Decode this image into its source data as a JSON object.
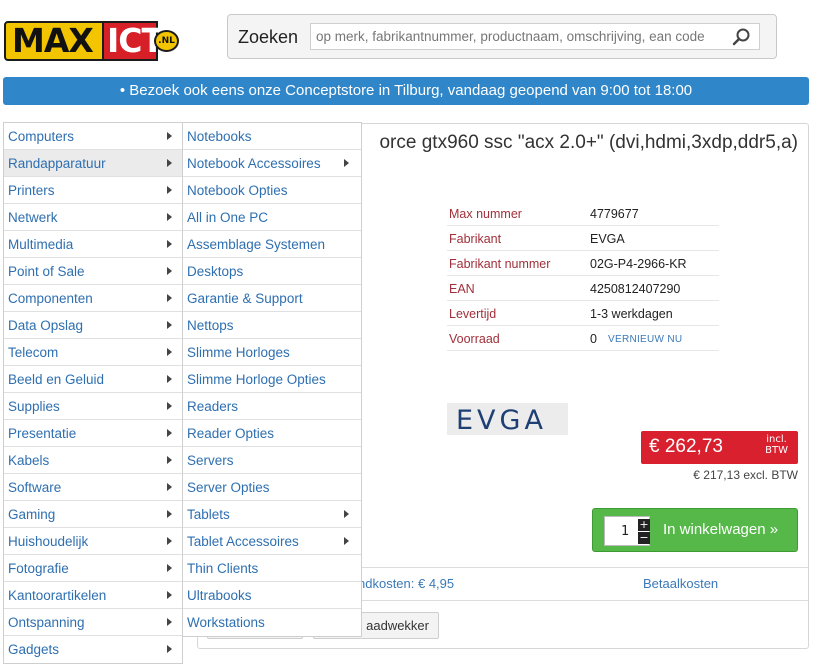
{
  "logo": {
    "max": "MAX",
    "ict": "ICT",
    "nl": ".NL"
  },
  "search": {
    "label": "Zoeken",
    "placeholder": "op merk, fabrikantnummer, productnaam, omschrijving, ean code"
  },
  "banner": {
    "text": "• Bezoek ook eens onze Conceptstore in Tilburg, vandaag geopend van 9:00 tot 18:00"
  },
  "categories": [
    {
      "label": "Computers",
      "has_sub": true
    },
    {
      "label": "Randapparatuur",
      "has_sub": true,
      "active": true
    },
    {
      "label": "Printers",
      "has_sub": true
    },
    {
      "label": "Netwerk",
      "has_sub": true
    },
    {
      "label": "Multimedia",
      "has_sub": true
    },
    {
      "label": "Point of Sale",
      "has_sub": true
    },
    {
      "label": "Componenten",
      "has_sub": true
    },
    {
      "label": "Data Opslag",
      "has_sub": true
    },
    {
      "label": "Telecom",
      "has_sub": true
    },
    {
      "label": "Beeld en Geluid",
      "has_sub": true
    },
    {
      "label": "Supplies",
      "has_sub": true
    },
    {
      "label": "Presentatie",
      "has_sub": true
    },
    {
      "label": "Kabels",
      "has_sub": true
    },
    {
      "label": "Software",
      "has_sub": true
    },
    {
      "label": "Gaming",
      "has_sub": true
    },
    {
      "label": "Huishoudelijk",
      "has_sub": true
    },
    {
      "label": "Fotografie",
      "has_sub": true
    },
    {
      "label": "Kantoorartikelen",
      "has_sub": true
    },
    {
      "label": "Ontspanning",
      "has_sub": true
    },
    {
      "label": "Gadgets",
      "has_sub": true
    }
  ],
  "subcategories": [
    {
      "label": "Notebooks",
      "has_sub": false
    },
    {
      "label": "Notebook Accessoires",
      "has_sub": true
    },
    {
      "label": "Notebook Opties",
      "has_sub": false
    },
    {
      "label": "All in One PC",
      "has_sub": false
    },
    {
      "label": "Assemblage Systemen",
      "has_sub": false
    },
    {
      "label": "Desktops",
      "has_sub": false
    },
    {
      "label": "Garantie & Support",
      "has_sub": false
    },
    {
      "label": "Nettops",
      "has_sub": false
    },
    {
      "label": "Slimme Horloges",
      "has_sub": false
    },
    {
      "label": "Slimme Horloge Opties",
      "has_sub": false
    },
    {
      "label": "Readers",
      "has_sub": false
    },
    {
      "label": "Reader Opties",
      "has_sub": false
    },
    {
      "label": "Servers",
      "has_sub": false
    },
    {
      "label": "Server Opties",
      "has_sub": false
    },
    {
      "label": "Tablets",
      "has_sub": true
    },
    {
      "label": "Tablet Accessoires",
      "has_sub": true
    },
    {
      "label": "Thin Clients",
      "has_sub": false
    },
    {
      "label": "Ultrabooks",
      "has_sub": false
    },
    {
      "label": "Workstations",
      "has_sub": false
    }
  ],
  "product": {
    "title_visible": "orce gtx960 ssc \"acx 2.0+\" (dvi,hdmi,3xdp,ddr5,a)",
    "specs": [
      {
        "key": "Max nummer",
        "value": "4779677"
      },
      {
        "key": "Fabrikant",
        "value": "EVGA"
      },
      {
        "key": "Fabrikant nummer",
        "value": "02G-P4-2966-KR"
      },
      {
        "key": "EAN",
        "value": "4250812407290"
      },
      {
        "key": "Levertijd",
        "value": "1-3 werkdagen"
      },
      {
        "key": "Voorraad",
        "value": "0",
        "action": "VERNIEUW NU"
      }
    ],
    "brand_logo": "EVGA",
    "price": "€ 262,73",
    "price_incl_1": "incl.",
    "price_incl_2": "BTW",
    "price_excl": "€ 217,13 excl. BTW",
    "quantity": "1",
    "cart_label": "In winkelwagen »",
    "shipping_visible": "ndkosten: € 4,95",
    "payment_costs": "Betaalkosten",
    "alert_button_visible": "aadwekker"
  },
  "colors": {
    "banner": "#2f86c9",
    "price": "#d8202f",
    "cart": "#55b848",
    "link": "#2e6fb0",
    "spec_key": "#a0303a"
  }
}
